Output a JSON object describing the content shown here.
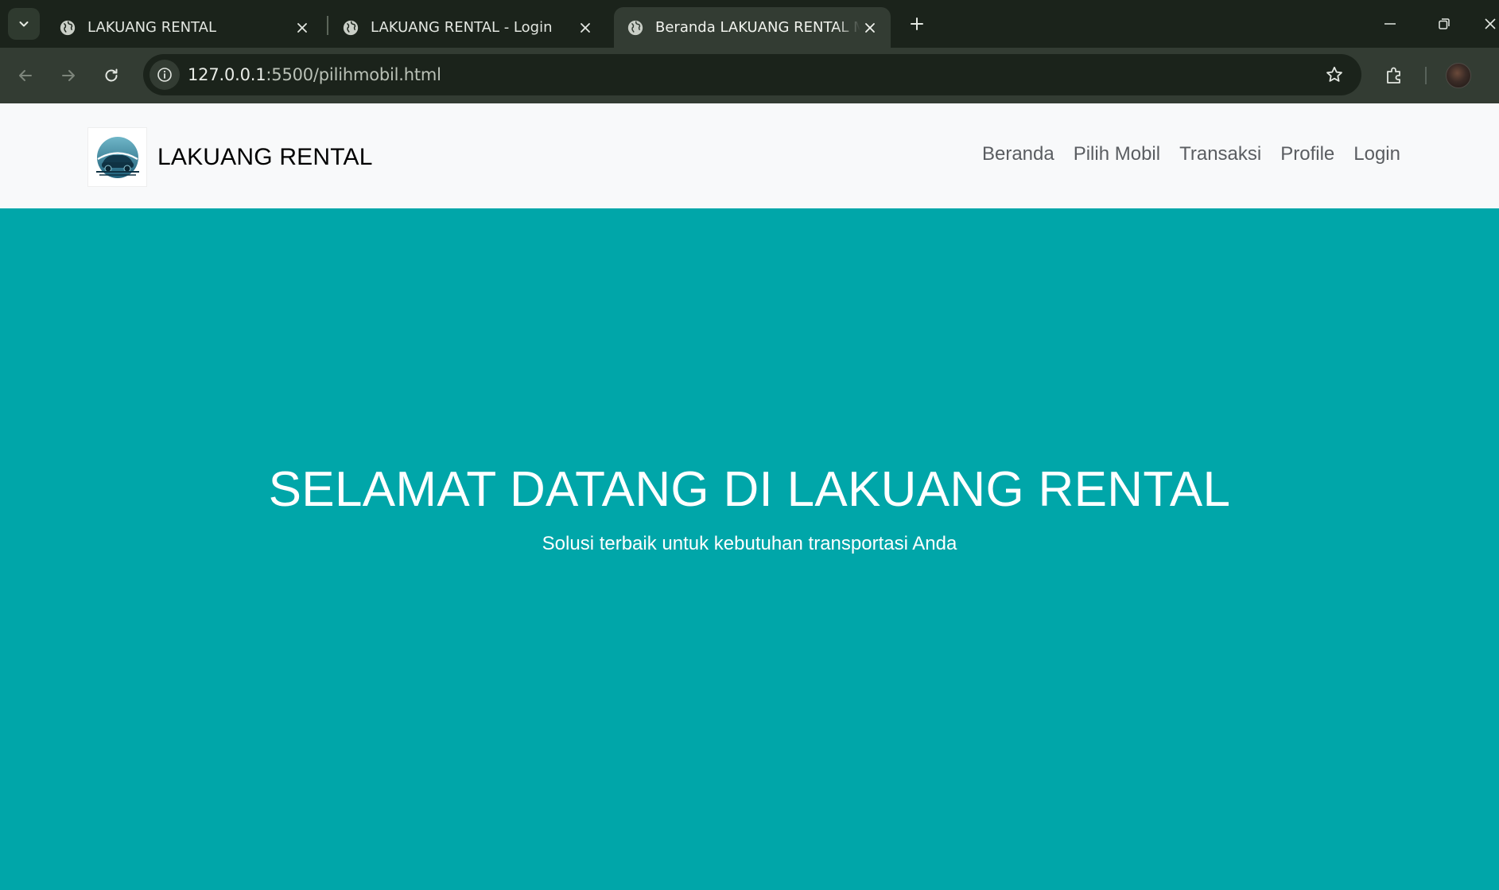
{
  "browser": {
    "tabs": [
      {
        "title": "LAKUANG RENTAL",
        "active": false
      },
      {
        "title": "LAKUANG RENTAL - Login",
        "active": false
      },
      {
        "title": "Beranda LAKUANG RENTAL Mobil",
        "active": true
      }
    ],
    "url_host": "127.0.0.1",
    "url_rest": ":5500/pilihmobil.html",
    "colors": {
      "tabstrip": "#1b231b",
      "toolbar": "#333c33"
    }
  },
  "navbar": {
    "brand": "LAKUANG RENTAL",
    "links": [
      "Beranda",
      "Pilih Mobil",
      "Transaksi",
      "Profile",
      "Login"
    ]
  },
  "hero": {
    "title": "SELAMAT DATANG DI LAKUANG RENTAL",
    "subtitle": "Solusi terbaik untuk kebutuhan transportasi Anda",
    "background": "#00a6a9"
  },
  "icons": {
    "tab_search": "chevron-down-icon",
    "tab_favicon": "globe-icon",
    "tab_close": "close-icon",
    "new_tab": "plus-icon",
    "back": "arrow-left-icon",
    "forward": "arrow-right-icon",
    "reload": "reload-icon",
    "site_info": "info-icon",
    "bookmark": "star-icon",
    "extensions": "puzzle-icon",
    "logo": "car-logo-icon"
  }
}
